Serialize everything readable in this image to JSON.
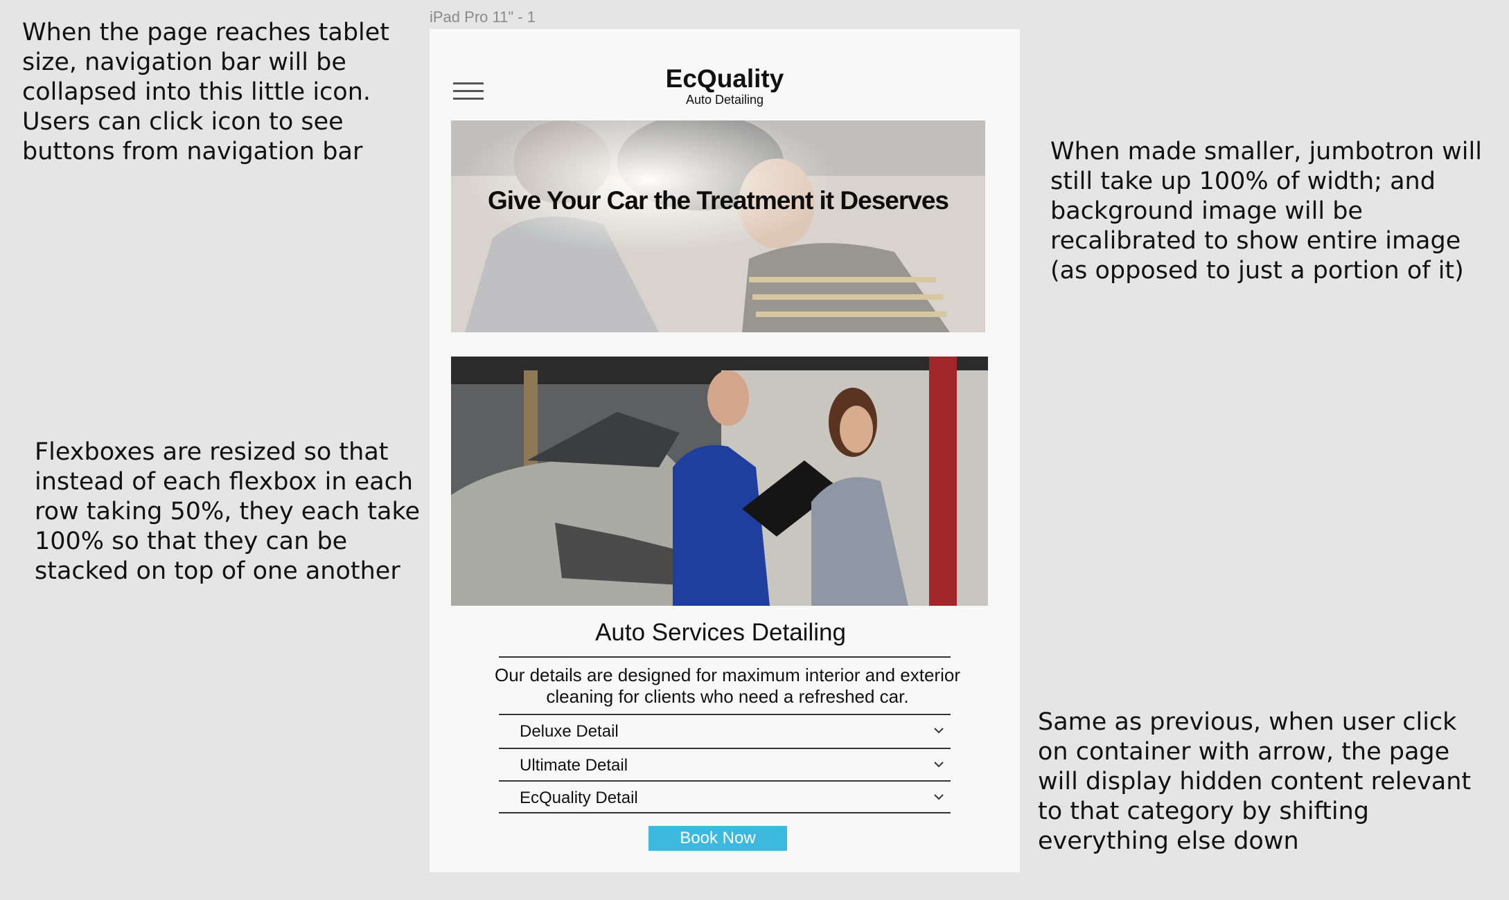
{
  "frame_label": "iPad Pro 11\" - 1",
  "notes": {
    "navigation": "When the page reaches tablet size, navigation bar will be collapsed into this little icon. Users can click icon to see buttons from navigation bar",
    "jumbotron": "When made smaller, jumbotron will still take up 100% of width; and background image will be recalibrated to show entire image (as opposed to just a portion of it)",
    "flexbox": "Flexboxes are resized so that instead of each flexbox in each row taking 50%, they each take 100% so that they can be stacked on top of one another",
    "accordion": "Same as previous, when user click on container with arrow, the page will display hidden content relevant to that category  by shifting everything else down"
  },
  "header": {
    "menu_icon": "hamburger-menu-icon",
    "brand_name": "EcQuality",
    "brand_subtitle": "Auto Detailing"
  },
  "jumbotron": {
    "title": "Give Your Car the Treatment it Deserves"
  },
  "services": {
    "title": "Auto Services Detailing",
    "description": "Our details are designed for maximum interior and exterior cleaning for clients who need a refreshed car.",
    "items": [
      {
        "label": "Deluxe Detail",
        "icon": "chevron-down-icon"
      },
      {
        "label": "Ultimate Detail",
        "icon": "chevron-down-icon"
      },
      {
        "label": "EcQuality Detail",
        "icon": "chevron-down-icon"
      }
    ],
    "book_label": "Book Now"
  },
  "colors": {
    "background": "#e5e5e5",
    "frame": "#f8f8f8",
    "button": "#3db8df"
  }
}
